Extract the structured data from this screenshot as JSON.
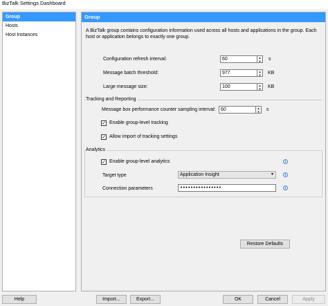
{
  "window": {
    "title": "BizTalk Settings Dashboard"
  },
  "sidebar": {
    "items": [
      {
        "label": "Group",
        "selected": true
      },
      {
        "label": "Hosts",
        "selected": false
      },
      {
        "label": "Host Instances",
        "selected": false
      }
    ]
  },
  "main": {
    "header": "Group",
    "description": "A BizTalk group contains configuration information used across all hosts and applications in the group. Each host or application belongs to exactly one group.",
    "config_refresh": {
      "label": "Configuration refresh interval:",
      "value": "60",
      "unit": "s"
    },
    "batch_threshold": {
      "label": "Message batch threshold:",
      "value": "977",
      "unit": "KB"
    },
    "large_message": {
      "label": "Large message size:",
      "value": "100",
      "unit": "KB"
    },
    "tracking": {
      "title": "Tracking and Reporting",
      "sampling": {
        "label": "Message box performance counter sampling interval:",
        "value": "60",
        "unit": "s"
      },
      "enable_tracking": {
        "label": "Enable group-level tracking",
        "checked": true
      },
      "allow_import": {
        "label": "Allow import of tracking settings",
        "checked": true
      }
    },
    "analytics": {
      "title": "Analytics",
      "enable_analytics": {
        "label": "Enable group-level analytics",
        "checked": true
      },
      "target_type": {
        "label": "Target type",
        "value": "Application Insight"
      },
      "connection": {
        "label": "Connection parameters",
        "value": "••••••••••••••••"
      }
    },
    "restore_defaults": "Restore Defaults"
  },
  "footer": {
    "help": "Help",
    "import": "Import...",
    "export": "Export...",
    "ok": "OK",
    "cancel": "Cancel",
    "apply": "Apply"
  },
  "icons": {
    "checkmark": "✓",
    "info": "i",
    "spin_up": "▲",
    "spin_down": "▼",
    "dropdown": "▾"
  }
}
